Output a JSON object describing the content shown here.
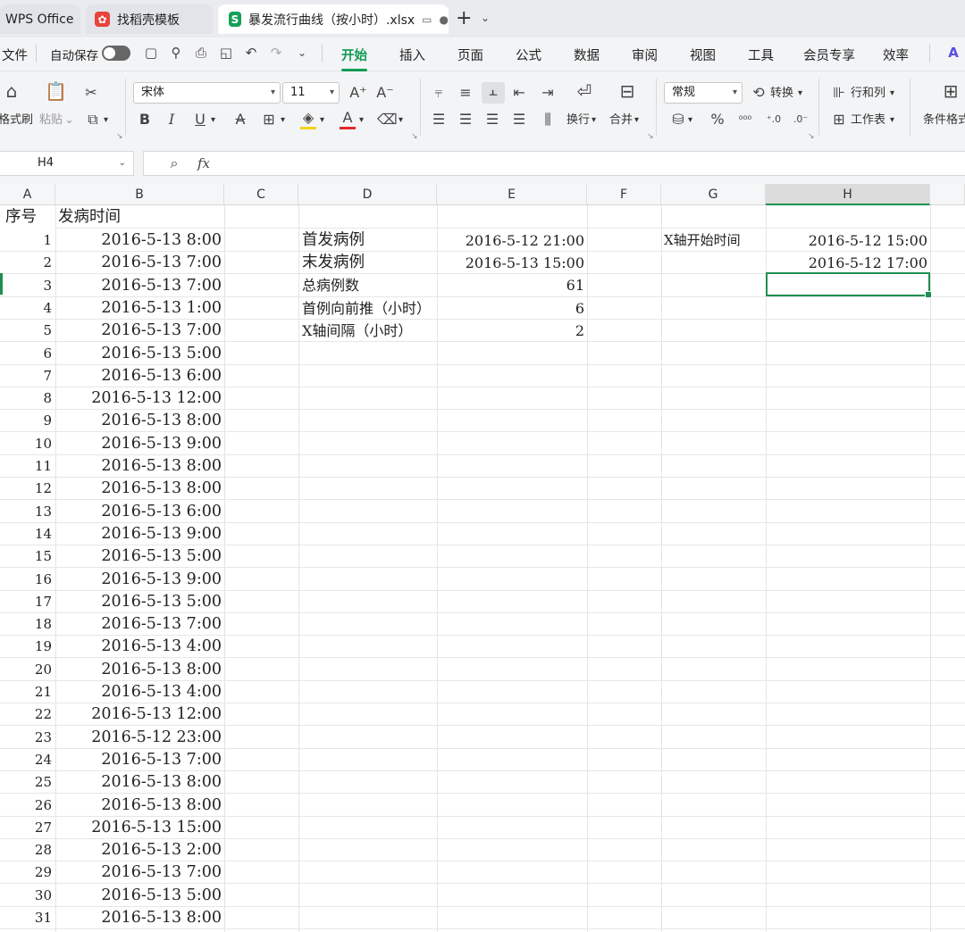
{
  "tabs": {
    "wps": "WPS Office",
    "template": "找稻壳模板",
    "document": "暴发流行曲线（按小时）.xlsx"
  },
  "menu": {
    "file": "文件",
    "autosave": "自动保存",
    "items": [
      "开始",
      "插入",
      "页面",
      "公式",
      "数据",
      "审阅",
      "视图",
      "工具",
      "会员专享",
      "效率"
    ]
  },
  "ribbon": {
    "format_painter": "格式刷",
    "paste": "粘贴",
    "font_name": "宋体",
    "font_size": "11",
    "wrap": "换行",
    "merge": "合并",
    "number_format": "常规",
    "convert": "转换",
    "row_col": "行和列",
    "worksheet": "工作表",
    "cond_format": "条件格式"
  },
  "formula_bar": {
    "cell_ref": "H4",
    "fx": "fx",
    "content": ""
  },
  "columns": [
    "A",
    "B",
    "C",
    "D",
    "E",
    "F",
    "G",
    "H"
  ],
  "selected_column": "H",
  "sheet": {
    "header_a": "序号",
    "header_b": "发病时间",
    "onset_times": [
      "2016-5-13 8:00",
      "2016-5-13 7:00",
      "2016-5-13 7:00",
      "2016-5-13 1:00",
      "2016-5-13 7:00",
      "2016-5-13 5:00",
      "2016-5-13 6:00",
      "2016-5-13 12:00",
      "2016-5-13 8:00",
      "2016-5-13 9:00",
      "2016-5-13 8:00",
      "2016-5-13 8:00",
      "2016-5-13 6:00",
      "2016-5-13 9:00",
      "2016-5-13 5:00",
      "2016-5-13 9:00",
      "2016-5-13 5:00",
      "2016-5-13 7:00",
      "2016-5-13 4:00",
      "2016-5-13 8:00",
      "2016-5-13 4:00",
      "2016-5-13 12:00",
      "2016-5-12 23:00",
      "2016-5-13 7:00",
      "2016-5-13 8:00",
      "2016-5-13 8:00",
      "2016-5-13 15:00",
      "2016-5-13 2:00",
      "2016-5-13 7:00",
      "2016-5-13 5:00",
      "2016-5-13 8:00"
    ],
    "summary": {
      "first_case_label": "首发病例",
      "first_case_value": "2016-5-12 21:00",
      "last_case_label": "末发病例",
      "last_case_value": "2016-5-13 15:00",
      "total_label": "总病例数",
      "total_value": "61",
      "push_back_label": "首例向前推（小时）",
      "push_back_value": "6",
      "x_interval_label": "X轴间隔（小时）",
      "x_interval_value": "2"
    },
    "x_axis": {
      "start_label": "X轴开始时间",
      "start_value": "2016-5-12 15:00",
      "second_value": "2016-5-12 17:00"
    }
  }
}
